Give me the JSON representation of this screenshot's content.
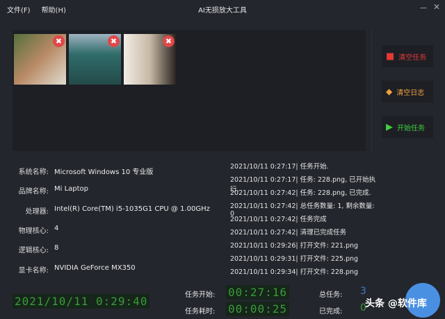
{
  "menu": {
    "file": "文件(F)",
    "help": "帮助(H)"
  },
  "window": {
    "title": "AI无损放大工具",
    "minimize": "－",
    "close": "✕"
  },
  "thumbnails": [
    {
      "remove": "✖",
      "color": "#6c7a4c"
    },
    {
      "remove": "✖",
      "color": "#2f6c6a"
    },
    {
      "remove": "✖",
      "color": "#d9cfc2"
    }
  ],
  "buttons": {
    "clear_tasks": "清空任务",
    "clear_log": "清空日志",
    "start": "开始任务"
  },
  "system": [
    {
      "label": "系统名称:",
      "value": "Microsoft Windows 10 专业版"
    },
    {
      "label": "品牌名称:",
      "value": "Mi Laptop"
    },
    {
      "label": "处理器:",
      "value": "Intel(R) Core(TM) i5-1035G1 CPU @ 1.00GHz"
    },
    {
      "label": "物理核心:",
      "value": "4"
    },
    {
      "label": "逻辑核心:",
      "value": "8"
    },
    {
      "label": "显卡名称:",
      "value": "NVIDIA GeForce MX350"
    }
  ],
  "log": [
    "2021/10/11 0:27:17| 任务开始.",
    "2021/10/11 0:27:17| 任务: 228.png, 已开始执行.",
    "2021/10/11 0:27:42| 任务: 228.png, 已完成.",
    "2021/10/11 0:27:42| 总任务数量: 1, 剩余数量: 0",
    "2021/10/11 0:27:42| 任务完成",
    "2021/10/11 0:27:42| 清理已完成任务",
    "2021/10/11 0:29:26| 打开文件: 221.png",
    "2021/10/11 0:29:31| 打开文件: 225.png",
    "2021/10/11 0:29:34| 打开文件: 228.png"
  ],
  "status": {
    "clock": "2021/10/11 0:29:40",
    "start_label": "任务开始:",
    "start_value": "00:27:16",
    "elapsed_label": "任务耗时:",
    "elapsed_value": "00:00:25",
    "total_label": "总任务:",
    "total_value": "3",
    "done_label": "已完成:",
    "done_value": "0"
  },
  "watermark": "头条 @软件库"
}
